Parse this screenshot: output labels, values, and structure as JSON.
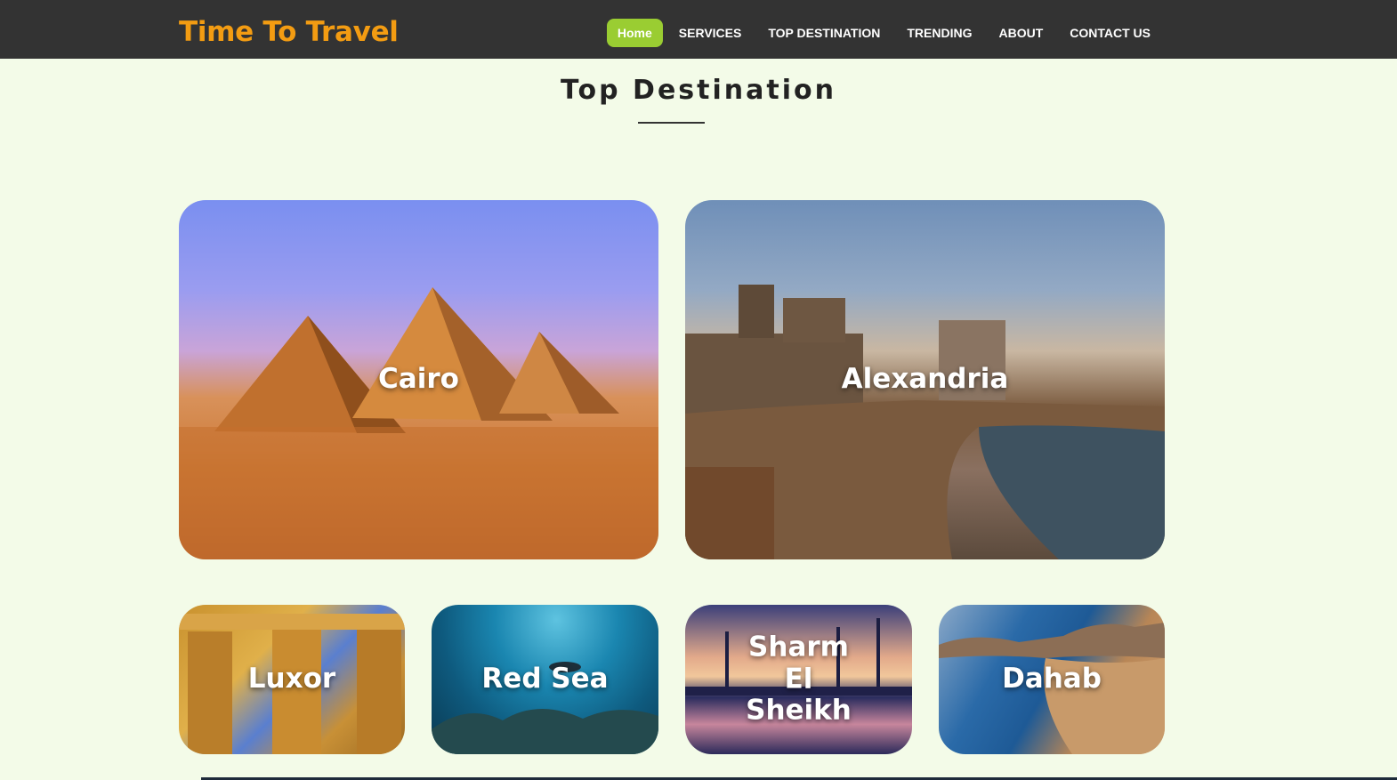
{
  "header": {
    "brand": "Time To Travel",
    "brand_color": "#f39c12",
    "nav": [
      {
        "label": "Home",
        "active": true
      },
      {
        "label": "SERVICES"
      },
      {
        "label": "TOP DESTINATION"
      },
      {
        "label": "TRENDING"
      },
      {
        "label": "ABOUT"
      },
      {
        "label": "CONTACT US"
      }
    ],
    "active_color": "#9acd32"
  },
  "section": {
    "title": "Top Destination"
  },
  "destinations": [
    {
      "name": "Cairo"
    },
    {
      "name": "Alexandria"
    },
    {
      "name": "Luxor"
    },
    {
      "name": "Red Sea"
    },
    {
      "name": "Sharm El Sheikh"
    },
    {
      "name": "Dahab"
    }
  ]
}
